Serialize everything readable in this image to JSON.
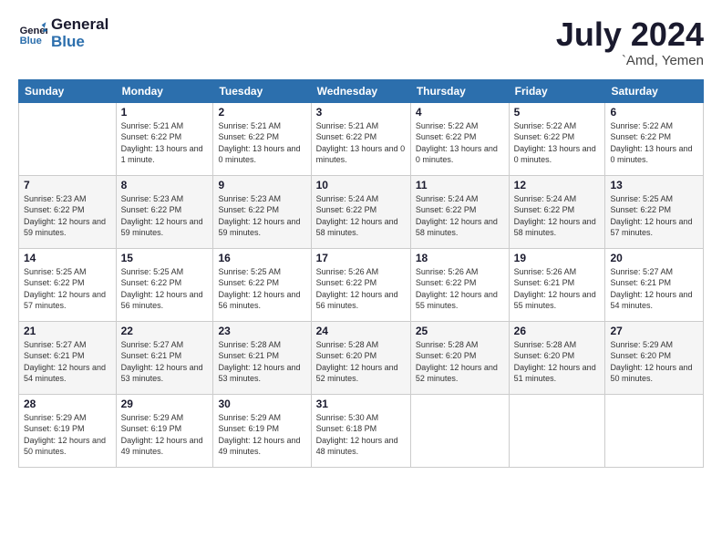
{
  "header": {
    "logo_line1": "General",
    "logo_line2": "Blue",
    "month_year": "July 2024",
    "location": "`Amd, Yemen"
  },
  "weekdays": [
    "Sunday",
    "Monday",
    "Tuesday",
    "Wednesday",
    "Thursday",
    "Friday",
    "Saturday"
  ],
  "weeks": [
    [
      {
        "day": "",
        "sunrise": "",
        "sunset": "",
        "daylight": ""
      },
      {
        "day": "1",
        "sunrise": "Sunrise: 5:21 AM",
        "sunset": "Sunset: 6:22 PM",
        "daylight": "Daylight: 13 hours and 1 minute."
      },
      {
        "day": "2",
        "sunrise": "Sunrise: 5:21 AM",
        "sunset": "Sunset: 6:22 PM",
        "daylight": "Daylight: 13 hours and 0 minutes."
      },
      {
        "day": "3",
        "sunrise": "Sunrise: 5:21 AM",
        "sunset": "Sunset: 6:22 PM",
        "daylight": "Daylight: 13 hours and 0 minutes."
      },
      {
        "day": "4",
        "sunrise": "Sunrise: 5:22 AM",
        "sunset": "Sunset: 6:22 PM",
        "daylight": "Daylight: 13 hours and 0 minutes."
      },
      {
        "day": "5",
        "sunrise": "Sunrise: 5:22 AM",
        "sunset": "Sunset: 6:22 PM",
        "daylight": "Daylight: 13 hours and 0 minutes."
      },
      {
        "day": "6",
        "sunrise": "Sunrise: 5:22 AM",
        "sunset": "Sunset: 6:22 PM",
        "daylight": "Daylight: 13 hours and 0 minutes."
      }
    ],
    [
      {
        "day": "7",
        "sunrise": "Sunrise: 5:23 AM",
        "sunset": "Sunset: 6:22 PM",
        "daylight": "Daylight: 12 hours and 59 minutes."
      },
      {
        "day": "8",
        "sunrise": "Sunrise: 5:23 AM",
        "sunset": "Sunset: 6:22 PM",
        "daylight": "Daylight: 12 hours and 59 minutes."
      },
      {
        "day": "9",
        "sunrise": "Sunrise: 5:23 AM",
        "sunset": "Sunset: 6:22 PM",
        "daylight": "Daylight: 12 hours and 59 minutes."
      },
      {
        "day": "10",
        "sunrise": "Sunrise: 5:24 AM",
        "sunset": "Sunset: 6:22 PM",
        "daylight": "Daylight: 12 hours and 58 minutes."
      },
      {
        "day": "11",
        "sunrise": "Sunrise: 5:24 AM",
        "sunset": "Sunset: 6:22 PM",
        "daylight": "Daylight: 12 hours and 58 minutes."
      },
      {
        "day": "12",
        "sunrise": "Sunrise: 5:24 AM",
        "sunset": "Sunset: 6:22 PM",
        "daylight": "Daylight: 12 hours and 58 minutes."
      },
      {
        "day": "13",
        "sunrise": "Sunrise: 5:25 AM",
        "sunset": "Sunset: 6:22 PM",
        "daylight": "Daylight: 12 hours and 57 minutes."
      }
    ],
    [
      {
        "day": "14",
        "sunrise": "Sunrise: 5:25 AM",
        "sunset": "Sunset: 6:22 PM",
        "daylight": "Daylight: 12 hours and 57 minutes."
      },
      {
        "day": "15",
        "sunrise": "Sunrise: 5:25 AM",
        "sunset": "Sunset: 6:22 PM",
        "daylight": "Daylight: 12 hours and 56 minutes."
      },
      {
        "day": "16",
        "sunrise": "Sunrise: 5:25 AM",
        "sunset": "Sunset: 6:22 PM",
        "daylight": "Daylight: 12 hours and 56 minutes."
      },
      {
        "day": "17",
        "sunrise": "Sunrise: 5:26 AM",
        "sunset": "Sunset: 6:22 PM",
        "daylight": "Daylight: 12 hours and 56 minutes."
      },
      {
        "day": "18",
        "sunrise": "Sunrise: 5:26 AM",
        "sunset": "Sunset: 6:22 PM",
        "daylight": "Daylight: 12 hours and 55 minutes."
      },
      {
        "day": "19",
        "sunrise": "Sunrise: 5:26 AM",
        "sunset": "Sunset: 6:21 PM",
        "daylight": "Daylight: 12 hours and 55 minutes."
      },
      {
        "day": "20",
        "sunrise": "Sunrise: 5:27 AM",
        "sunset": "Sunset: 6:21 PM",
        "daylight": "Daylight: 12 hours and 54 minutes."
      }
    ],
    [
      {
        "day": "21",
        "sunrise": "Sunrise: 5:27 AM",
        "sunset": "Sunset: 6:21 PM",
        "daylight": "Daylight: 12 hours and 54 minutes."
      },
      {
        "day": "22",
        "sunrise": "Sunrise: 5:27 AM",
        "sunset": "Sunset: 6:21 PM",
        "daylight": "Daylight: 12 hours and 53 minutes."
      },
      {
        "day": "23",
        "sunrise": "Sunrise: 5:28 AM",
        "sunset": "Sunset: 6:21 PM",
        "daylight": "Daylight: 12 hours and 53 minutes."
      },
      {
        "day": "24",
        "sunrise": "Sunrise: 5:28 AM",
        "sunset": "Sunset: 6:20 PM",
        "daylight": "Daylight: 12 hours and 52 minutes."
      },
      {
        "day": "25",
        "sunrise": "Sunrise: 5:28 AM",
        "sunset": "Sunset: 6:20 PM",
        "daylight": "Daylight: 12 hours and 52 minutes."
      },
      {
        "day": "26",
        "sunrise": "Sunrise: 5:28 AM",
        "sunset": "Sunset: 6:20 PM",
        "daylight": "Daylight: 12 hours and 51 minutes."
      },
      {
        "day": "27",
        "sunrise": "Sunrise: 5:29 AM",
        "sunset": "Sunset: 6:20 PM",
        "daylight": "Daylight: 12 hours and 50 minutes."
      }
    ],
    [
      {
        "day": "28",
        "sunrise": "Sunrise: 5:29 AM",
        "sunset": "Sunset: 6:19 PM",
        "daylight": "Daylight: 12 hours and 50 minutes."
      },
      {
        "day": "29",
        "sunrise": "Sunrise: 5:29 AM",
        "sunset": "Sunset: 6:19 PM",
        "daylight": "Daylight: 12 hours and 49 minutes."
      },
      {
        "day": "30",
        "sunrise": "Sunrise: 5:29 AM",
        "sunset": "Sunset: 6:19 PM",
        "daylight": "Daylight: 12 hours and 49 minutes."
      },
      {
        "day": "31",
        "sunrise": "Sunrise: 5:30 AM",
        "sunset": "Sunset: 6:18 PM",
        "daylight": "Daylight: 12 hours and 48 minutes."
      },
      {
        "day": "",
        "sunrise": "",
        "sunset": "",
        "daylight": ""
      },
      {
        "day": "",
        "sunrise": "",
        "sunset": "",
        "daylight": ""
      },
      {
        "day": "",
        "sunrise": "",
        "sunset": "",
        "daylight": ""
      }
    ]
  ]
}
